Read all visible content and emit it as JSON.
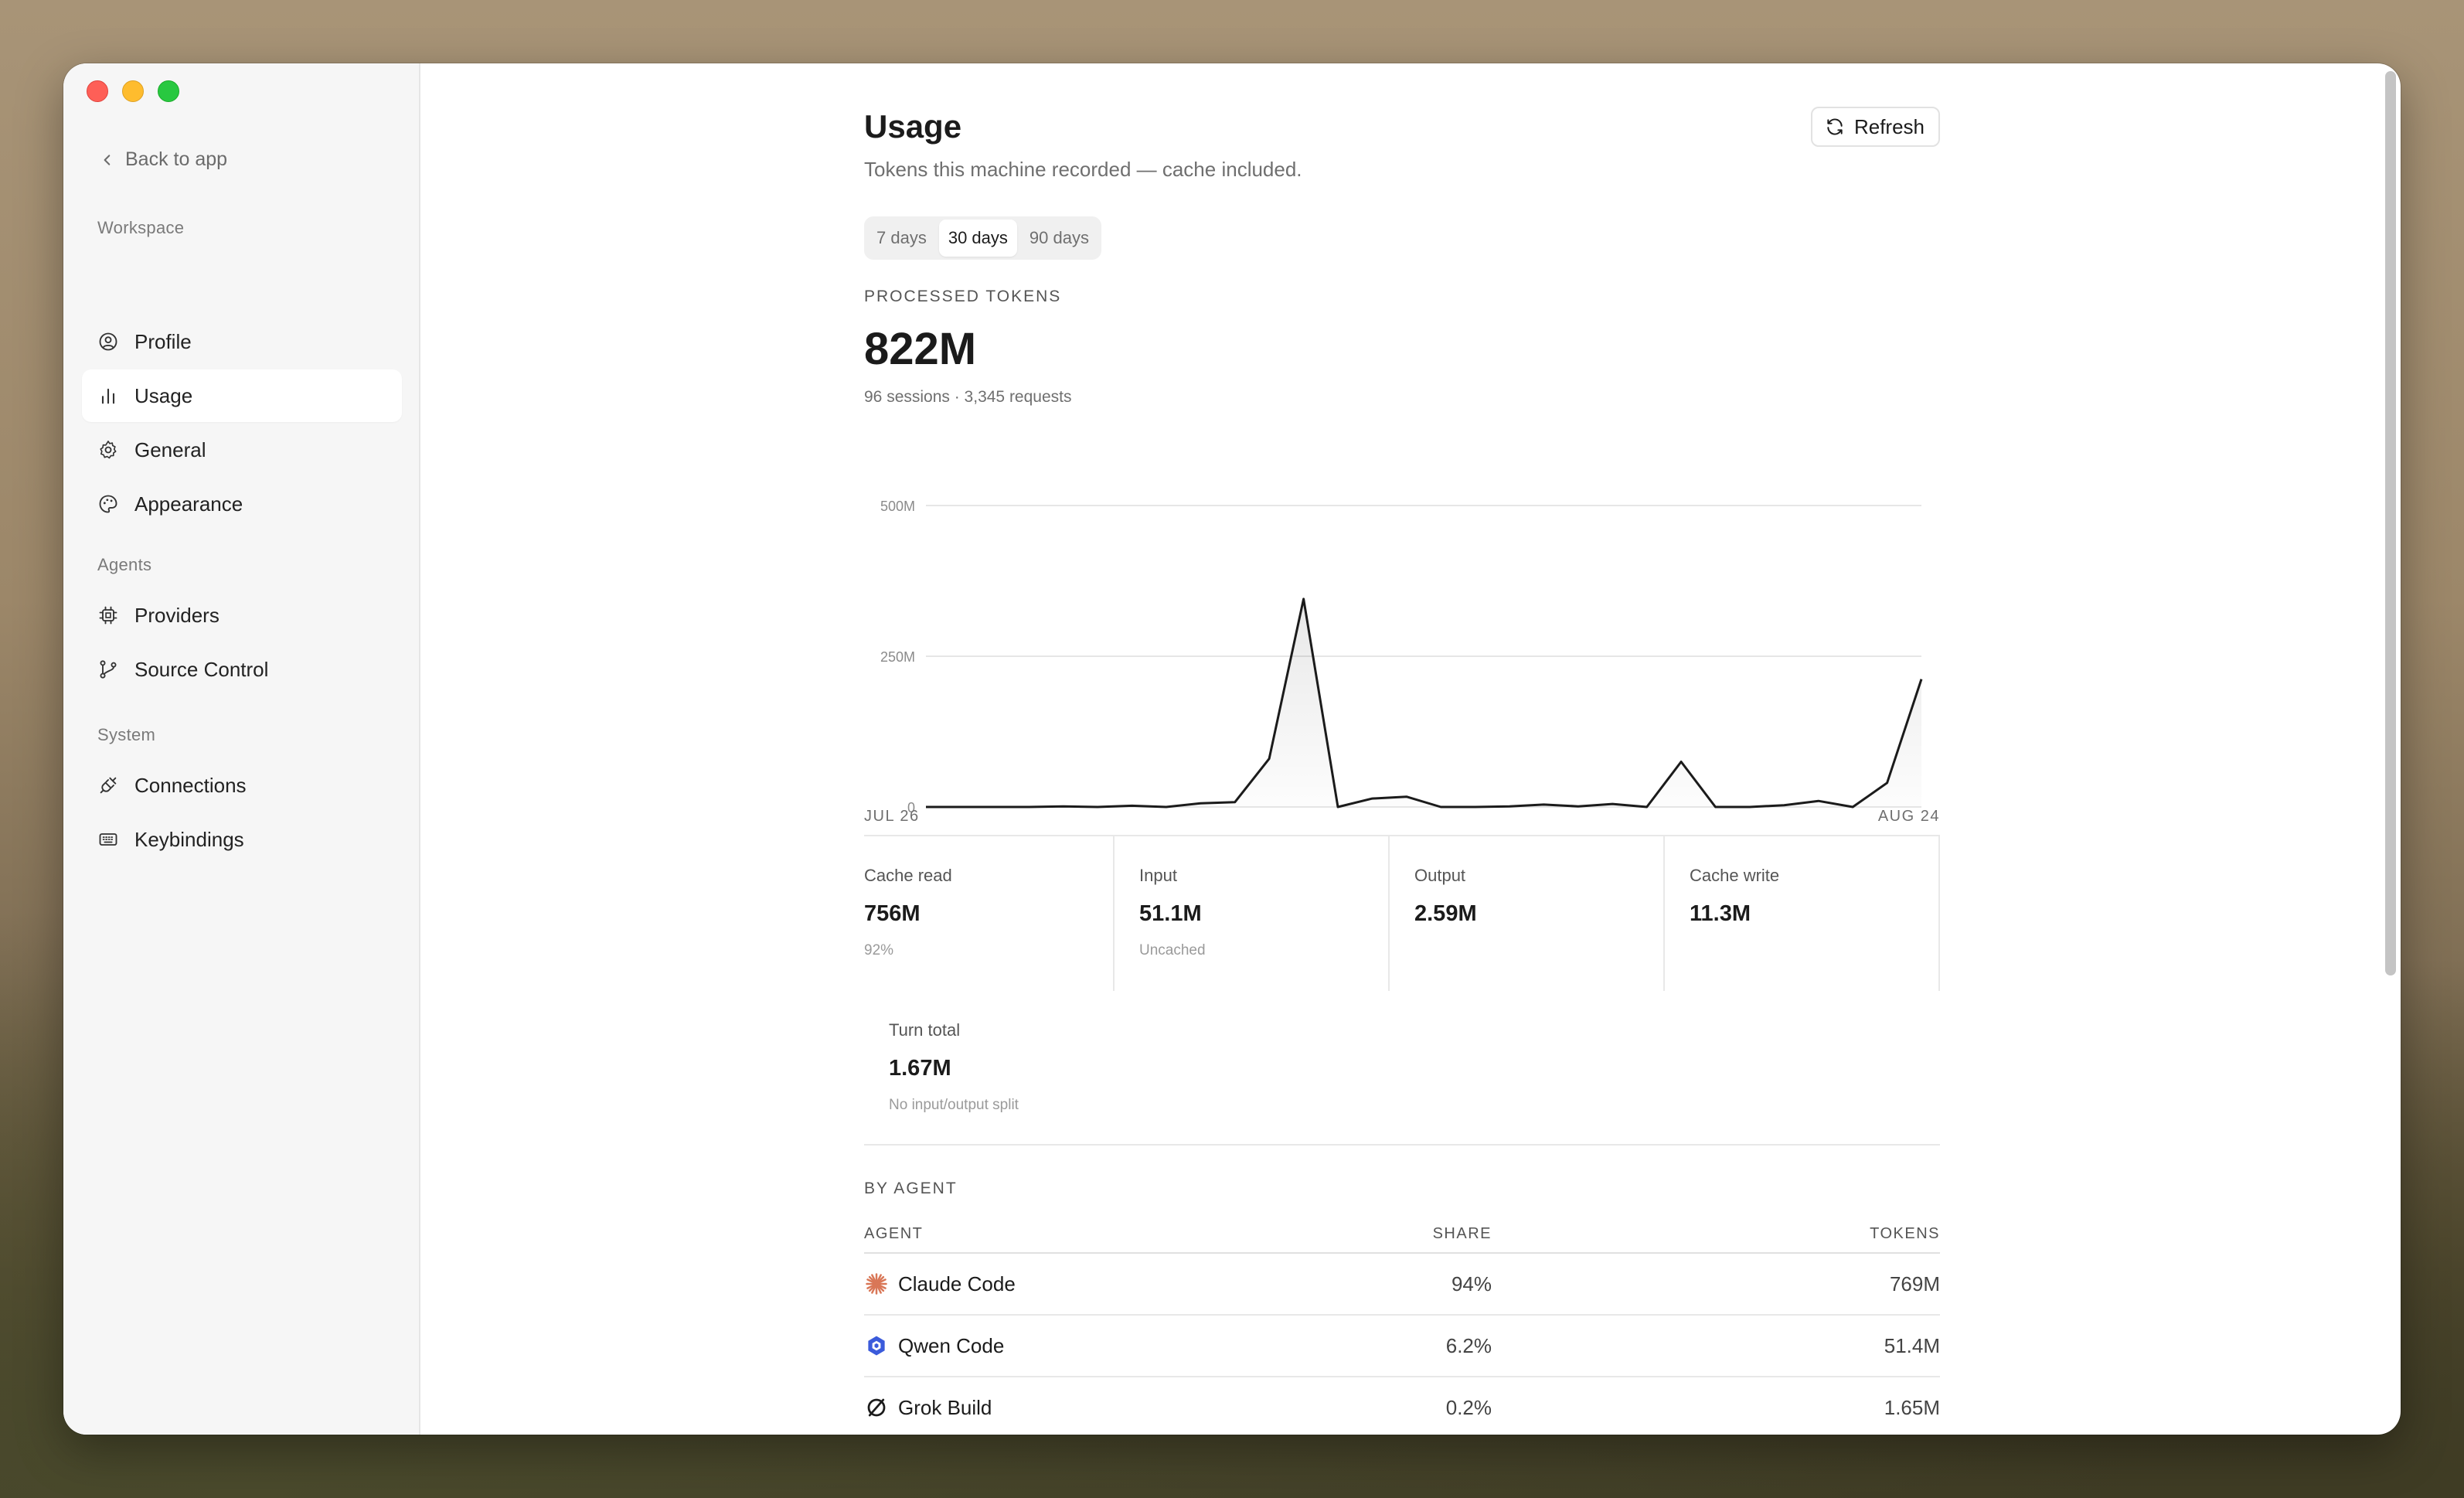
{
  "sidebar": {
    "back_label": "Back to app",
    "sections": [
      {
        "label": "Workspace"
      },
      {
        "label": "Agents"
      },
      {
        "label": "System"
      }
    ],
    "items": [
      {
        "label": "Profile",
        "icon": "user-circle-icon"
      },
      {
        "label": "Usage",
        "icon": "bar-chart-icon",
        "active": true
      },
      {
        "label": "General",
        "icon": "gear-icon"
      },
      {
        "label": "Appearance",
        "icon": "palette-icon"
      },
      {
        "label": "Providers",
        "icon": "chip-icon"
      },
      {
        "label": "Source Control",
        "icon": "git-branch-icon"
      },
      {
        "label": "Connections",
        "icon": "plug-icon"
      },
      {
        "label": "Keybindings",
        "icon": "keyboard-icon"
      }
    ]
  },
  "header": {
    "title": "Usage",
    "subtitle": "Tokens this machine recorded — cache included.",
    "refresh_label": "Refresh"
  },
  "range": {
    "options": [
      "7 days",
      "30 days",
      "90 days"
    ],
    "selected": "30 days"
  },
  "summary": {
    "kicker": "PROCESSED TOKENS",
    "total": "822M",
    "meta": "96 sessions · 3,345 requests"
  },
  "chart_data": {
    "type": "area",
    "x_start_label": "JUL 26",
    "x_end_label": "AUG 24",
    "y_ticks": [
      "500M",
      "250M",
      "0"
    ],
    "ylim": [
      0,
      500
    ],
    "y_unit": "M",
    "values": [
      0,
      0,
      0,
      0,
      1,
      0,
      2,
      0,
      6,
      8,
      80,
      345,
      0,
      14,
      17,
      0,
      0,
      1,
      4,
      1,
      5,
      0,
      75,
      0,
      0,
      3,
      10,
      0,
      40,
      212
    ],
    "grid": true,
    "colors": {
      "line": "#1b1b1b",
      "grid": "#e6e6e6"
    }
  },
  "stats": [
    {
      "label": "Cache read",
      "value": "756M",
      "note": "92%"
    },
    {
      "label": "Input",
      "value": "51.1M",
      "note": "Uncached"
    },
    {
      "label": "Output",
      "value": "2.59M",
      "note": ""
    },
    {
      "label": "Cache write",
      "value": "11.3M",
      "note": ""
    }
  ],
  "turn": {
    "label": "Turn total",
    "value": "1.67M",
    "note": "No input/output split"
  },
  "agents": {
    "kicker": "BY AGENT",
    "columns": {
      "agent": "AGENT",
      "share": "SHARE",
      "tokens": "TOKENS"
    },
    "rows": [
      {
        "name": "Claude Code",
        "share": "94%",
        "tokens": "769M",
        "icon": "claude-icon",
        "color": "#d97757"
      },
      {
        "name": "Qwen Code",
        "share": "6.2%",
        "tokens": "51.4M",
        "icon": "qwen-icon",
        "color": "#3b5bdb"
      },
      {
        "name": "Grok Build",
        "share": "0.2%",
        "tokens": "1.65M",
        "icon": "grok-icon",
        "color": "#1b1b1b"
      }
    ]
  }
}
